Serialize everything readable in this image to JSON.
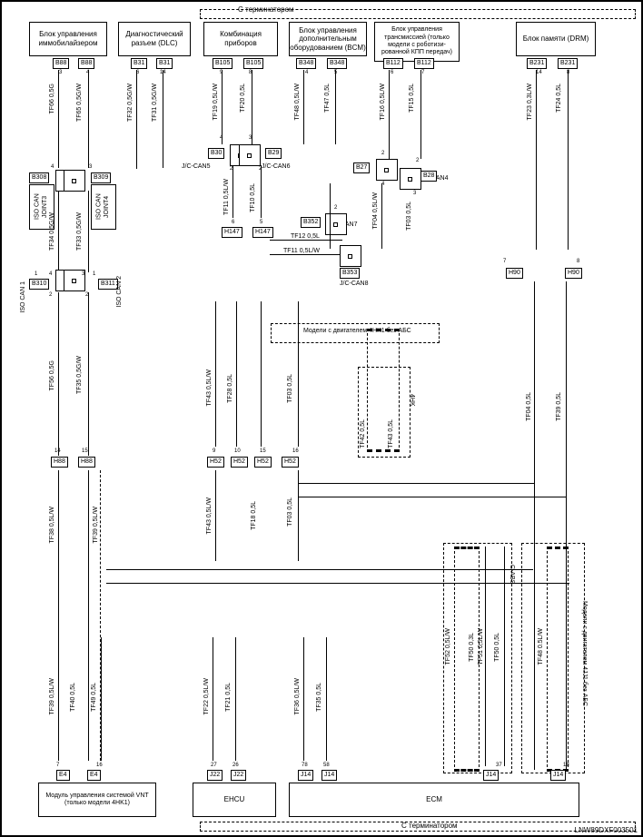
{
  "header": {
    "terminator_top": "С терминатором",
    "terminator_bottom": "С терминатором"
  },
  "footer": {
    "code": "LNW89DXF003501"
  },
  "boxes": {
    "immo": "Блок управления иммобилайзером",
    "diag": "Диагностический разъем (DLC)",
    "cluster": "Комбинация приборов",
    "bcm": "Блок управления дополнительным оборудованием (BCM)",
    "tcm": "Блок управления трансмиссией (только модели с роботизи-рованной КПП передач)",
    "drm": "Блок памяти (DRM)",
    "vnt": "Модуль управления системой VNT (только модели 4HK1)",
    "ehcu": "EHCU",
    "ecm": "ECM",
    "iso_can_joint3": "ISO CAN JOINT3",
    "iso_can_joint4": "ISO CAN JOINT4",
    "iso_can1": "ISO CAN 1",
    "iso_can2": "ISO CAN 2",
    "jc_can5": "J/C-CAN5",
    "jc_can6": "J/C-CAN6",
    "jc_can7": "J/C-CAN7",
    "jc_can4": "J/C-CAN4",
    "jc_can8": "J/C-CAN8",
    "region_4hk1_no_abs": "Модели с двигателем 4HK1 без АБС",
    "region_4hk": "4HK",
    "region_cabs": "C-ABS",
    "region_4jj1_no_abs": "Модели с двигателем 4JJ1 без АБС"
  },
  "connectors": {
    "b88a": "B88",
    "b88b": "B88",
    "b31a": "B31",
    "b31b": "B31",
    "b105a": "B105",
    "b105b": "B105",
    "b348a": "B348",
    "b348b": "B348",
    "b112a": "B112",
    "b112b": "B112",
    "b231a": "B231",
    "b231b": "B231",
    "b30": "B30",
    "b29": "B29",
    "b27": "B27",
    "b28": "B28",
    "b352": "B352",
    "b353": "B353",
    "b308": "B308",
    "b309": "B309",
    "b310": "B310",
    "b311": "B311",
    "h147a": "H147",
    "h147b": "H147",
    "h90a": "H90",
    "h90b": "H90",
    "h88a": "H88",
    "h88b": "H88",
    "h52a": "H52",
    "h52b": "H52",
    "h52c": "H52",
    "h52d": "H52",
    "e4a": "E4",
    "e4b": "E4",
    "j22a": "J22",
    "j22b": "J22",
    "j14a": "J14",
    "j14b": "J14",
    "j14c": "J14",
    "j14d": "J14"
  },
  "wires": {
    "tf66_05g": "TF66 0,5G",
    "tf65_05gw": "TF65 0,5G/W",
    "tf32_05gw": "TF32 0,5G/W",
    "tf31_05gw": "TF31 0,5G/W",
    "tf19_05lw": "TF19 0,5L/W",
    "tf20_05l": "TF20 0,5L",
    "tf48_05lw": "TF48 0,5L/W",
    "tf47_05l": "TF47 0,5L",
    "tf16_05lw": "TF16 0,5L/W",
    "tf15_05l": "TF15 0,5L",
    "tf23_03lw": "TF23 0,3L/W",
    "tf24_05l": "TF24 0,5L",
    "tf34_05gw": "TF34 0,5G/W",
    "tf33_05gw": "TF33 0,5G/W",
    "tf11_05lw": "TF11 0,5L/W",
    "tf10_05l": "TF10 0,5L",
    "tf04_05lw": "TF04 0,5L/W",
    "tf03_05l": "TF03 0,5L",
    "tf12_05l": "TF12 0,5L",
    "tf11_05lw_2": "TF11 0,5L/W",
    "tf56_05g": "TF56 0,5G",
    "tf35_05gw": "TF35 0,5G/W",
    "tf43_05lw": "TF43 0,5L/W",
    "tf28_05l": "TF28 0,5L",
    "tf03_05l_2": "TF03 0,5L",
    "tf42_05l": "TF42 0,5L",
    "tf43_05l": "TF43 0,5L",
    "tf04_05l": "TF04 0,5L",
    "tf39_05lw": "TF39 0,5L/W",
    "tf40_05l": "TF40 0,5L",
    "tf18_05l": "TF18 0,5L",
    "tf03_05l_3": "TF03 0,5L",
    "tf38_05lw": "TF38 0,5L/W",
    "tf39_05l": "TF39 0,5L",
    "tf49_05l": "TF49 0,5L",
    "tf22_05lw": "TF22 0,5L/W",
    "tf21_05l": "TF21 0,5L",
    "tf36_05lw": "TF36 0,5L/W",
    "tf35_05l": "TF35 0,5L",
    "tf51_05lw": "TF51 0,5L/W",
    "tf50_05l": "TF50 0,5L",
    "tf52_05lw": "TF52 0,5L/W",
    "tf50_03l": "TF50 0,3L",
    "tf48_05lw_2": "TF48 0.5L/W"
  }
}
